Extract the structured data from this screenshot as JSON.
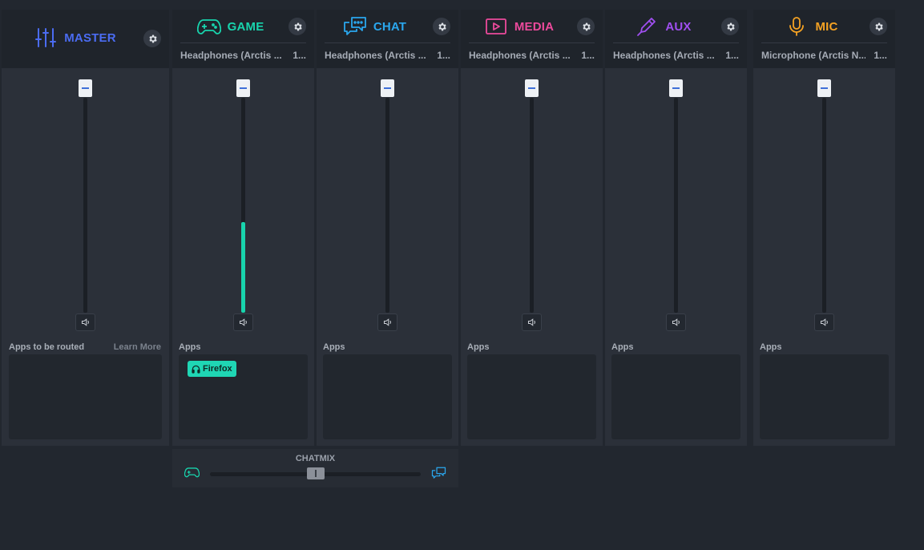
{
  "colors": {
    "master": "#4b6cf2",
    "game": "#18d4ad",
    "chat": "#2aa7ee",
    "media": "#ec4a9c",
    "aux": "#a04ff0",
    "mic": "#f5a223"
  },
  "channels": [
    {
      "id": "master",
      "label": "MASTER",
      "icon": "sliders-icon",
      "device": "",
      "device_extra": "",
      "level": 0,
      "apps_label": "Apps to be routed",
      "learn_more": "Learn More",
      "apps": []
    },
    {
      "id": "game",
      "label": "GAME",
      "icon": "gamepad-icon",
      "device": "Headphones (Arctis ...",
      "device_extra": "1...",
      "level": 0.42,
      "apps_label": "Apps",
      "apps": [
        {
          "name": "Firefox",
          "icon": "headphones-icon"
        }
      ]
    },
    {
      "id": "chat",
      "label": "CHAT",
      "icon": "chat-icon",
      "device": "Headphones (Arctis ...",
      "device_extra": "1...",
      "level": 0,
      "apps_label": "Apps",
      "apps": []
    },
    {
      "id": "media",
      "label": "MEDIA",
      "icon": "play-icon",
      "device": "Headphones (Arctis ...",
      "device_extra": "1...",
      "level": 0,
      "apps_label": "Apps",
      "apps": []
    },
    {
      "id": "aux",
      "label": "AUX",
      "icon": "pen-icon",
      "device": "Headphones (Arctis ...",
      "device_extra": "1...",
      "level": 0,
      "apps_label": "Apps",
      "apps": []
    },
    {
      "id": "mic",
      "label": "MIC",
      "icon": "microphone-icon",
      "device": "Microphone (Arctis N...",
      "device_extra": "1...",
      "level": 0,
      "apps_label": "Apps",
      "apps": []
    }
  ],
  "chatmix": {
    "label": "CHATMIX",
    "balance": 0.5
  }
}
